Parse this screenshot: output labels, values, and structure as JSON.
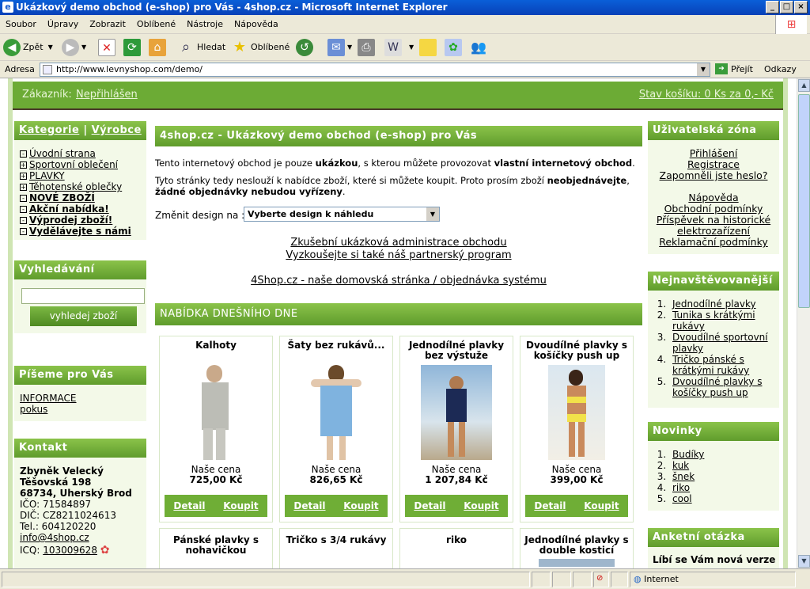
{
  "window": {
    "title": "Ukázkový demo obchod (e-shop) pro Vás - 4shop.cz - Microsoft Internet Explorer"
  },
  "menu": [
    "Soubor",
    "Úpravy",
    "Zobrazit",
    "Oblíbené",
    "Nástroje",
    "Nápověda"
  ],
  "toolbar": {
    "back": "Zpět",
    "search": "Hledat",
    "favorites": "Oblíbené"
  },
  "address": {
    "label": "Adresa",
    "url": "http://www.levnyshop.com/demo/",
    "go": "Přejít",
    "links": "Odkazy"
  },
  "status": {
    "zone": "Internet"
  },
  "site": {
    "customer_label": "Zákazník:",
    "customer_value": "Nepřihlášen",
    "cart": "Stav košíku: 0 Ks za 0,- Kč",
    "left": {
      "cat_tab": "Kategorie",
      "sep": "|",
      "maker_tab": "Výrobce",
      "categories": [
        {
          "label": "Úvodní strana",
          "bold": false
        },
        {
          "label": "Sportovní oblečení",
          "bold": false
        },
        {
          "label": "PLAVKY",
          "bold": false
        },
        {
          "label": "Těhotenské oblečky",
          "bold": false
        },
        {
          "label": "NOVÉ ZBOŽÍ",
          "bold": true
        },
        {
          "label": "Akční nabídka!",
          "bold": true
        },
        {
          "label": "Výprodej zboží!",
          "bold": true
        },
        {
          "label": "Vydělávejte s námi",
          "bold": true
        }
      ],
      "search_title": "Vyhledávání",
      "search_button": "vyhledej zboží",
      "write_title": "Píšeme pro Vás",
      "write_links": [
        "INFORMACE",
        "pokus"
      ],
      "contact_title": "Kontakt",
      "contact": {
        "name": "Zbyněk Velecký",
        "street": "Těšovská 198",
        "city": "68734, Uherský Brod",
        "ico": "IČO: 71584897",
        "dic": "DIČ: CZ8211024613",
        "tel": "Tel.: 604120220",
        "email": "info@4shop.cz",
        "icq_label": "ICQ:",
        "icq": "103009628"
      }
    },
    "center": {
      "title": "4shop.cz - Ukázkový demo obchod (e-shop) pro Vás",
      "p1a": "Tento internetový obchod je pouze ",
      "p1b": "ukázkou",
      "p1c": ", s kterou můžete provozovat ",
      "p1d": "vlastní internetový obchod",
      "p1e": ".",
      "p2a": "Tyto stránky tedy neslouží k nabídce zboží, které si můžete koupit. Proto prosím zboží ",
      "p2b": "neobjednávejte",
      "p2c": ", ",
      "p2d": "žádné objednávky nebudou vyřízeny",
      "p2e": ".",
      "design_label": "Změnit design na :",
      "design_select": "Vyberte design k náhledu",
      "links": [
        "Zkušební ukázková administrace obchodu",
        "Vyzkoušejte si také náš partnerský program",
        "4Shop.cz - naše domovská stránka / objednávka systému"
      ],
      "offer_title": "NABÍDKA DNEŠNÍHO DNE",
      "products": [
        {
          "name": "Kalhoty",
          "price_label": "Naše cena",
          "price": "725,00 Kč"
        },
        {
          "name": "Šaty bez rukávů...",
          "price_label": "Naše cena",
          "price": "826,65 Kč"
        },
        {
          "name": "Jednodílné plavky bez výstuže",
          "price_label": "Naše cena",
          "price": "1 207,84 Kč"
        },
        {
          "name": "Dvoudílné plavky s košíčky push up",
          "price_label": "Naše cena",
          "price": "399,00 Kč"
        }
      ],
      "products2": [
        {
          "name": "Pánské plavky s nohavičkou"
        },
        {
          "name": "Tričko s 3/4 rukávy"
        },
        {
          "name": "riko"
        },
        {
          "name": "Jednodílné plavky s double kosticí"
        }
      ],
      "detail": "Detail",
      "buy": "Koupit"
    },
    "right": {
      "user_title": "Uživatelská zóna",
      "user_links": [
        "Přihlášení",
        "Registrace",
        "Zapomněli jste heslo?"
      ],
      "info_links": [
        "Nápověda",
        "Obchodní podmínky",
        "Příspěvek na historické elektrozařízení",
        "Reklamační podmínky"
      ],
      "top_title": "Nejnavštěvovanější",
      "top": [
        "Jednodílné plavky",
        "Tunika s krátkými rukávy",
        "Dvoudílné sportovní plavky",
        "Tričko pánské s krátkými rukávy",
        "Dvoudílné plavky s košíčky push up"
      ],
      "news_title": "Novinky",
      "news": [
        "Budíky",
        "kuk",
        "šnek",
        "riko",
        "cool"
      ],
      "poll_title": "Anketní otázka",
      "poll_text": "Líbí se Vám nová verze"
    }
  }
}
